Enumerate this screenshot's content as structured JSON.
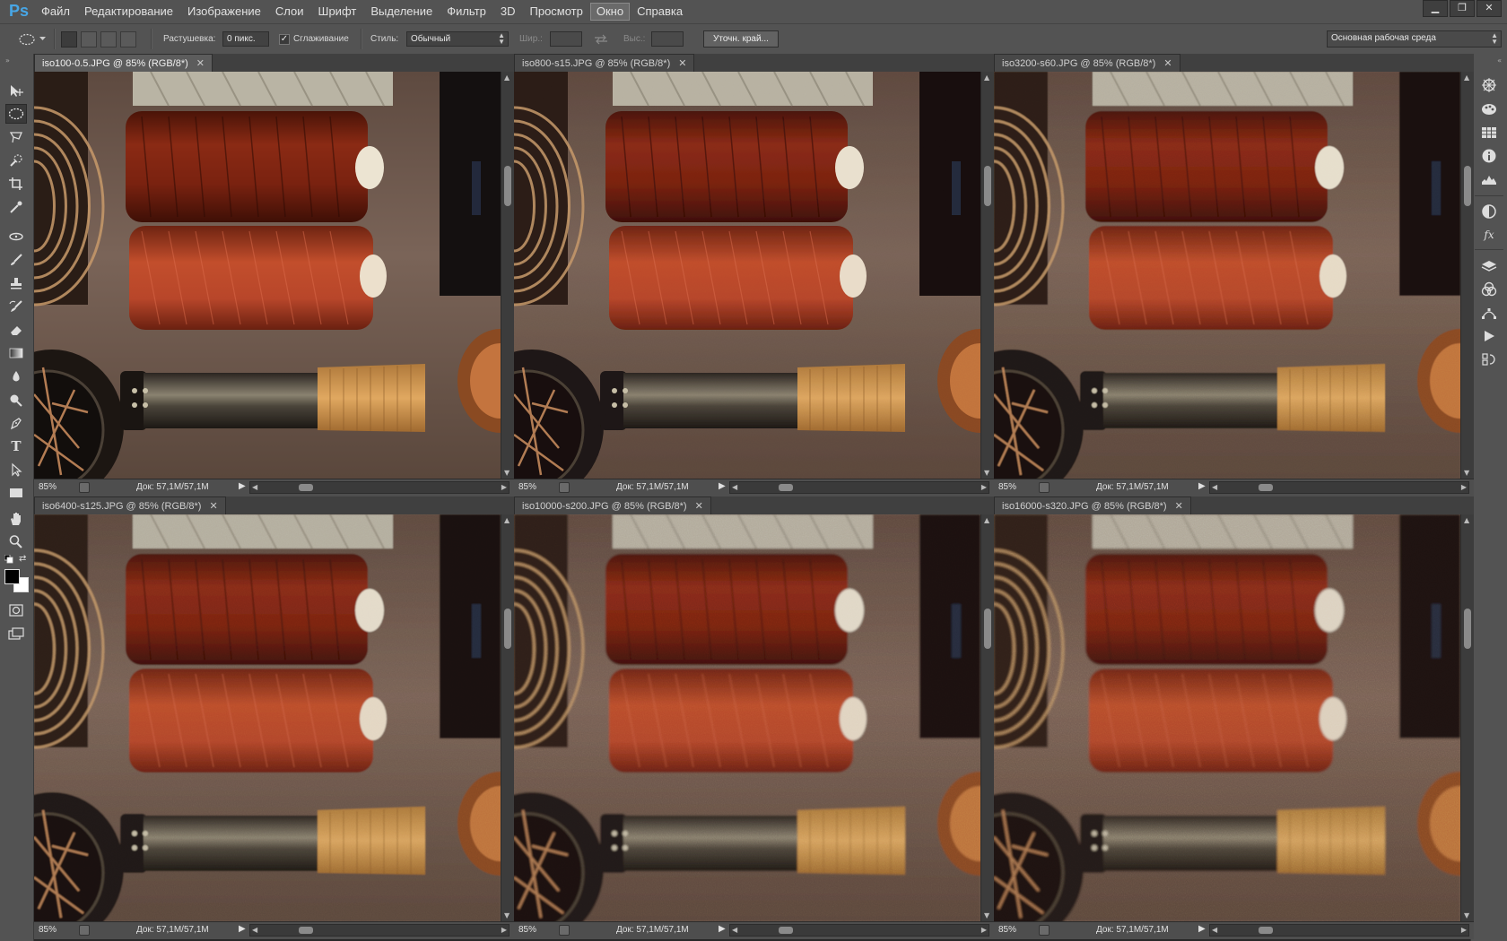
{
  "app": {
    "logo": "Ps"
  },
  "menu": [
    "Файл",
    "Редактирование",
    "Изображение",
    "Слои",
    "Шрифт",
    "Выделение",
    "Фильтр",
    "3D",
    "Просмотр",
    "Окно",
    "Справка"
  ],
  "menu_active_index": 9,
  "window_controls": {
    "minimize": "▁",
    "restore": "❐",
    "close": "✕"
  },
  "options": {
    "feather_label": "Растушевка:",
    "feather_value": "0 пикс.",
    "antialias_label": "Сглаживание",
    "antialias_checked": true,
    "style_label": "Стиль:",
    "style_value": "Обычный",
    "width_label": "Шир.:",
    "height_label": "Выс.:",
    "refine_edge_button": "Уточн. край...",
    "workspace_value": "Основная рабочая среда"
  },
  "documents": [
    {
      "title": "iso100-0.5.JPG @ 85% (RGB/8*)",
      "zoom": "85%",
      "doc_size": "Док: 57,1M/57,1M",
      "noise_level": 0.0,
      "active": true
    },
    {
      "title": "iso800-s15.JPG @ 85% (RGB/8*)",
      "zoom": "85%",
      "doc_size": "Док: 57,1M/57,1M",
      "noise_level": 0.15,
      "active": false
    },
    {
      "title": "iso3200-s60.JPG @ 85% (RGB/8*)",
      "zoom": "85%",
      "doc_size": "Док: 57,1M/57,1M",
      "noise_level": 0.35,
      "active": false
    },
    {
      "title": "iso6400-s125.JPG @ 85% (RGB/8*)",
      "zoom": "85%",
      "doc_size": "Док: 57,1M/57,1M",
      "noise_level": 0.5,
      "active": false
    },
    {
      "title": "iso10000-s200.JPG @ 85% (RGB/8*)",
      "zoom": "85%",
      "doc_size": "Док: 57,1M/57,1M",
      "noise_level": 0.7,
      "active": false
    },
    {
      "title": "iso16000-s320.JPG @ 85% (RGB/8*)",
      "zoom": "85%",
      "doc_size": "Док: 57,1M/57,1M",
      "noise_level": 0.9,
      "active": false
    }
  ],
  "tools": [
    "move-tool",
    "elliptical-marquee-tool",
    "lasso-tool",
    "quick-selection-tool",
    "crop-tool",
    "eyedropper-tool",
    "spot-healing-tool",
    "brush-tool",
    "clone-stamp-tool",
    "history-brush-tool",
    "eraser-tool",
    "gradient-tool",
    "blur-tool",
    "dodge-tool",
    "pen-tool",
    "type-tool",
    "path-selection-tool",
    "rectangle-tool",
    "hand-tool",
    "zoom-tool"
  ],
  "colors": {
    "foreground": "#000000",
    "background": "#ffffff",
    "ui_panel": "#535353",
    "ps_blue": "#47a6e6"
  },
  "type_tool_glyph": "T"
}
